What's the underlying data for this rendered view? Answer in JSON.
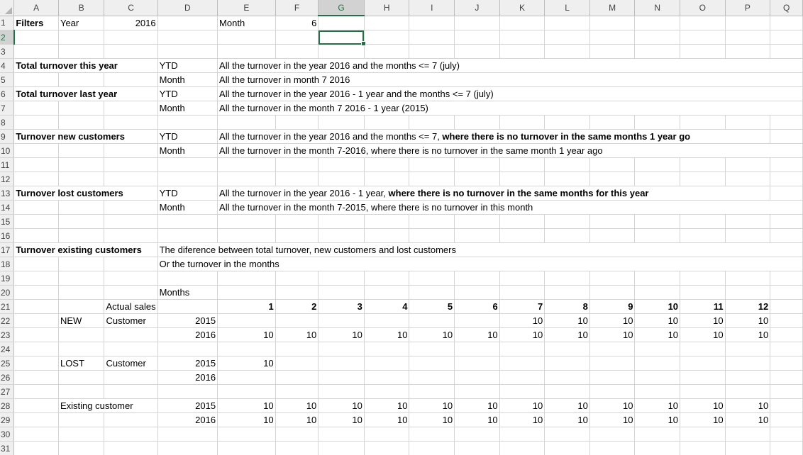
{
  "columns": [
    "A",
    "B",
    "C",
    "D",
    "E",
    "F",
    "G",
    "H",
    "I",
    "J",
    "K",
    "L",
    "M",
    "N",
    "O",
    "P",
    "Q"
  ],
  "rows": [
    "1",
    "2",
    "3",
    "4",
    "5",
    "6",
    "7",
    "8",
    "9",
    "10",
    "11",
    "12",
    "13",
    "14",
    "15",
    "16",
    "17",
    "18",
    "19",
    "20",
    "21",
    "22",
    "23",
    "24",
    "25",
    "26",
    "27",
    "28",
    "29",
    "30",
    "31"
  ],
  "selected_cell": "G2",
  "filters": {
    "label": "Filters",
    "year_label": "Year",
    "year_value": "2016",
    "month_label": "Month",
    "month_value": "6"
  },
  "sections": {
    "r4": {
      "title": "Total turnover this year",
      "type": "YTD",
      "desc": "All the turnover in the year 2016 and the months <= 7 (july)"
    },
    "r5": {
      "type": "Month",
      "desc": "All the turnover in month 7 2016"
    },
    "r6": {
      "title": "Total turnover last year",
      "type": "YTD",
      "desc": "All the turnover in the year 2016 - 1 year and the months <= 7 (july)"
    },
    "r7": {
      "type": "Month",
      "desc": "All the turnover in the month 7 2016 - 1 year (2015)"
    },
    "r9": {
      "title": "Turnover new customers",
      "type": "YTD",
      "desc_plain": "All the turnover in the year 2016 and the months <= 7, ",
      "desc_bold": "where there is no turnover in the same months 1 year go"
    },
    "r10": {
      "type": "Month",
      "desc": "All the turnover in the month 7-2016, where there is no turnover in the same month 1 year ago"
    },
    "r13": {
      "title": "Turnover lost customers",
      "type": "YTD",
      "desc_plain": "All the turnover in the year 2016 - 1 year, ",
      "desc_bold": "where there is no turnover in the same months for this year"
    },
    "r14": {
      "type": "Month",
      "desc": "All the turnover in the month 7-2015, where there is no turnover in this month"
    },
    "r17": {
      "title": "Turnover existing customers",
      "desc": "The diference between total turnover, new customers and lost customers"
    },
    "r18": {
      "desc": "Or the turnover in the months"
    }
  },
  "table": {
    "months_label": "Months",
    "actual_sales_label": "Actual sales",
    "month_headers": [
      "1",
      "2",
      "3",
      "4",
      "5",
      "6",
      "7",
      "8",
      "9",
      "10",
      "11",
      "12"
    ],
    "groups": [
      {
        "label": "NEW",
        "sublabel": "Customer",
        "rows": [
          {
            "year": "2015",
            "values": [
              "",
              "",
              "",
              "",
              "",
              "",
              "10",
              "10",
              "10",
              "10",
              "10",
              "10"
            ]
          },
          {
            "year": "2016",
            "values": [
              "10",
              "10",
              "10",
              "10",
              "10",
              "10",
              "10",
              "10",
              "10",
              "10",
              "10",
              "10"
            ]
          }
        ]
      },
      {
        "label": "LOST",
        "sublabel": "Customer",
        "rows": [
          {
            "year": "2015",
            "values": [
              "10",
              "",
              "",
              "",
              "",
              "",
              "",
              "",
              "",
              "",
              "",
              ""
            ]
          },
          {
            "year": "2016",
            "values": [
              "",
              "",
              "",
              "",
              "",
              "",
              "",
              "",
              "",
              "",
              "",
              ""
            ]
          }
        ]
      },
      {
        "label": "Existing customer",
        "sublabel": "",
        "rows": [
          {
            "year": "2015",
            "values": [
              "10",
              "10",
              "10",
              "10",
              "10",
              "10",
              "10",
              "10",
              "10",
              "10",
              "10",
              "10"
            ]
          },
          {
            "year": "2016",
            "values": [
              "10",
              "10",
              "10",
              "10",
              "10",
              "10",
              "10",
              "10",
              "10",
              "10",
              "10",
              "10"
            ]
          }
        ]
      }
    ]
  },
  "colors": {
    "selection": "#217346",
    "header_bg": "#efefef",
    "grid": "#d4d4d4"
  }
}
